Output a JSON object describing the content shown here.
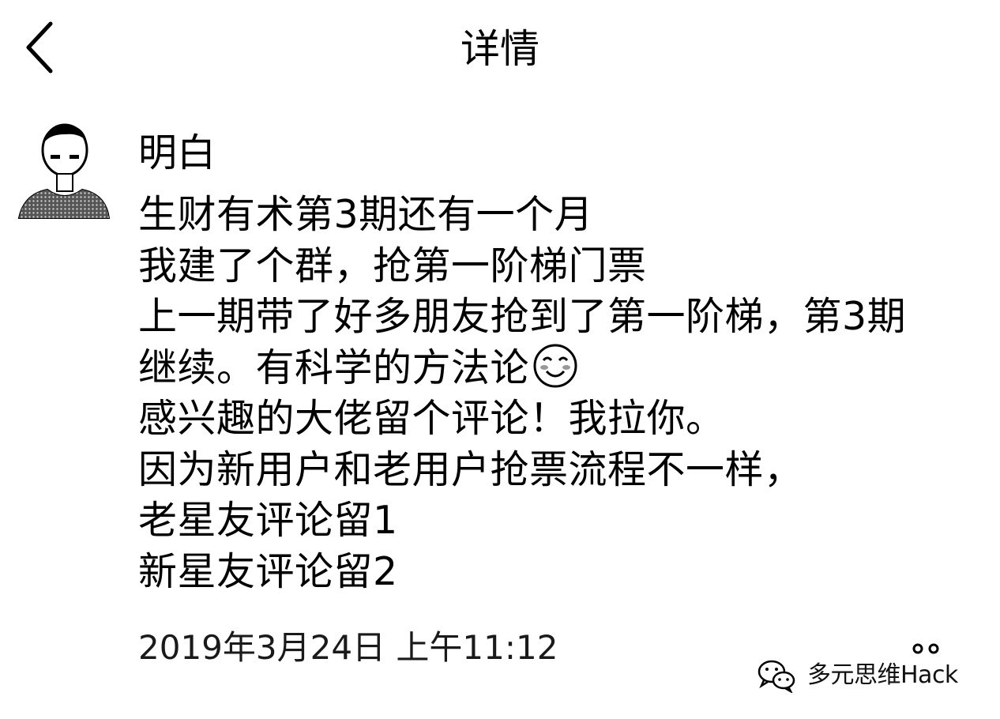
{
  "header": {
    "title": "详情",
    "back_icon": "chevron-left-icon"
  },
  "post": {
    "author": "明白",
    "avatar_icon": "user-avatar-icon",
    "lines": [
      "生财有术第3期还有一个月",
      "我建了个群，抢第一阶梯门票",
      "上一期带了好多朋友抢到了第一阶梯，第3期",
      "继续。有科学的方法论",
      "感兴趣的大佬留个评论！我拉你。",
      "因为新用户和老用户抢票流程不一样，",
      "老星友评论留1",
      "新星友评论留2"
    ],
    "emoji_icon": "smiley-icon",
    "timestamp": "2019年3月24日 上午11:12"
  },
  "watermark": {
    "icon": "wechat-icon",
    "text": "多元思维Hack"
  }
}
